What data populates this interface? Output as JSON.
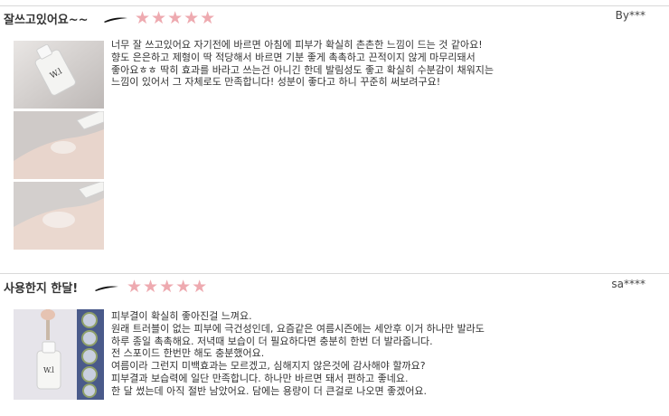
{
  "reviews": [
    {
      "title": "잘쓰고있어요~~",
      "stars": "★★★★★",
      "author": "By***",
      "lines": [
        "너무 잘 쓰고있어요 자기전에 바르면 아침에 피부가 확실히 촌촌한 느낌이 드는 것 같아요!",
        "향도 은은하고 제형이 딱 적당해서 바르면 기분 좋게 촉촉하고 끈적이지 않게 마무리돼서",
        "좋아요ㅎㅎ 딱히 효과를 바라고 쓰는건 아니긴 한데 발림성도 좋고 확실히 수분감이 채워지는",
        "느낌이 있어서 그 자체로도 만족합니다! 성분이 좋다고 하니 꾸준히 써보려구요!"
      ],
      "photos": [
        "serum bottle",
        "hand with serum",
        "hand with serum applied"
      ]
    },
    {
      "title": "사용한지 한달!",
      "stars": "★★★★★",
      "author": "sa****",
      "lines": [
        "피부결이 확실히 좋아진걸 느껴요.",
        "원래 트러블이 없는 피부에 극건성인데, 요즘같은 여름시즌에는 세안후 이거 하나만 발라도",
        "하루 종일 촉촉해요. 저녁때 보습이 더 필요하다면 충분히 한번 더 발라줍니다.",
        "전 스포이드 한번만 해도 충분했어요.",
        "여름이라 그런지 미백효과는 모르겠고, 심해지지 않은것에 감사해야 할까요?",
        "피부결과 보습력에 일단 만족합니다. 하나만 바르면 돼서 편하고 좋네요.",
        "한 달 썼는데 아직 절반 남았어요. 담에는 용량이 더 큰걸로 나오면 좋겠어요."
      ],
      "photos": [
        "serum dropper bottle with badges"
      ]
    }
  ],
  "colors": {
    "star": "#eeaab0",
    "divider": "#d9d9d9",
    "text": "#333333"
  }
}
